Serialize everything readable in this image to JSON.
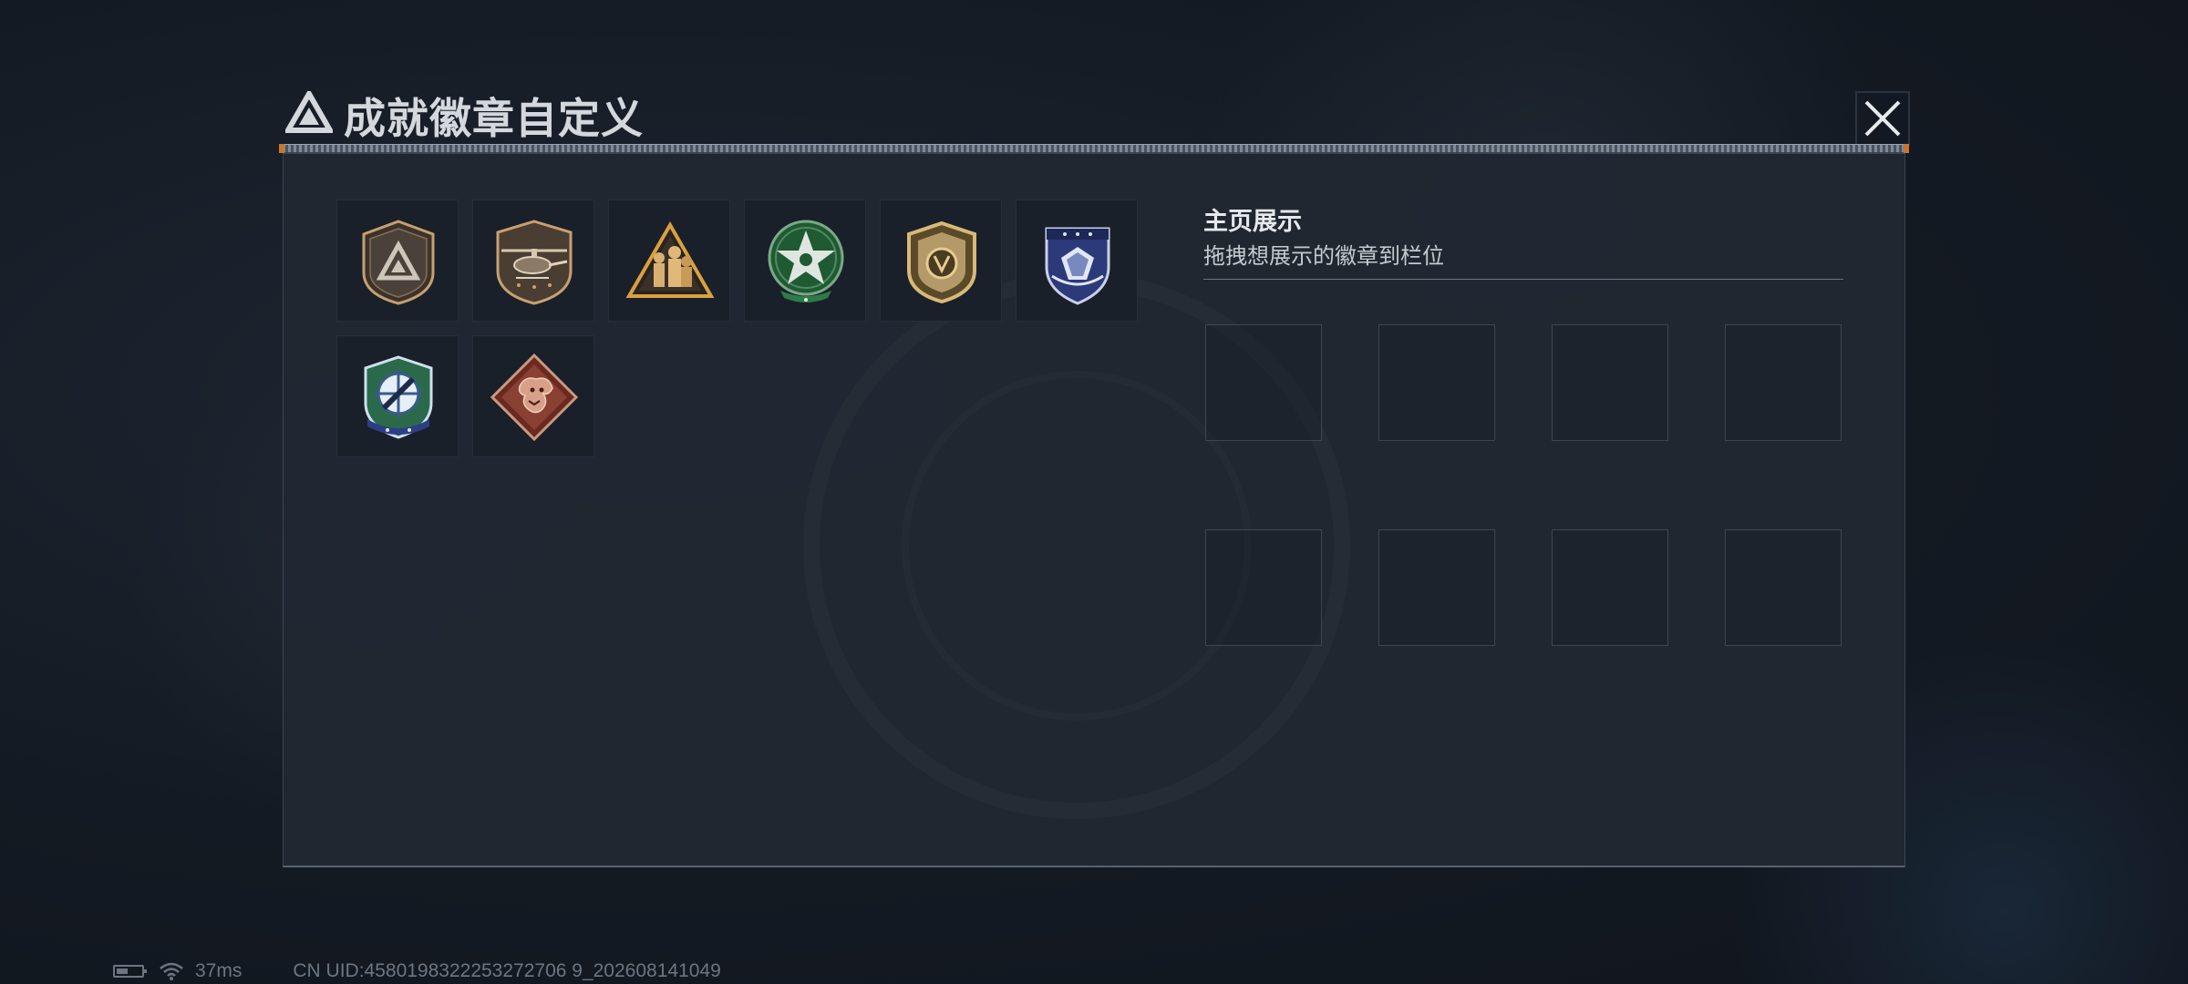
{
  "header": {
    "title": "成就徽章自定义",
    "logo_icon": "triangle-logo-icon",
    "close_icon": "close-icon"
  },
  "badges": [
    {
      "name": "triangle-emblem-badge",
      "colors": [
        "#3b3530",
        "#c8a070"
      ]
    },
    {
      "name": "helicopter-badge",
      "colors": [
        "#4a3e34",
        "#c8a070"
      ]
    },
    {
      "name": "soldiers-triangle-badge",
      "colors": [
        "#2a2420",
        "#d9a040"
      ]
    },
    {
      "name": "green-star-badge",
      "colors": [
        "#1f5a32",
        "#e8ece6"
      ]
    },
    {
      "name": "gold-shield-badge",
      "colors": [
        "#5a4a2a",
        "#d8b878"
      ]
    },
    {
      "name": "blue-diamond-badge",
      "colors": [
        "#2c3a7a",
        "#e0e6f4"
      ]
    },
    {
      "name": "crosshair-shield-badge",
      "colors": [
        "#2a6a4a",
        "#8fb8e0"
      ]
    },
    {
      "name": "dragon-badge",
      "colors": [
        "#6a2a22",
        "#d89a80"
      ]
    }
  ],
  "display": {
    "title": "主页展示",
    "hint": "拖拽想展示的徽章到栏位",
    "slot_count": 8
  },
  "status": {
    "ping": "37ms",
    "uid": "CN UID:4580198322253272706 9_202608141049"
  }
}
